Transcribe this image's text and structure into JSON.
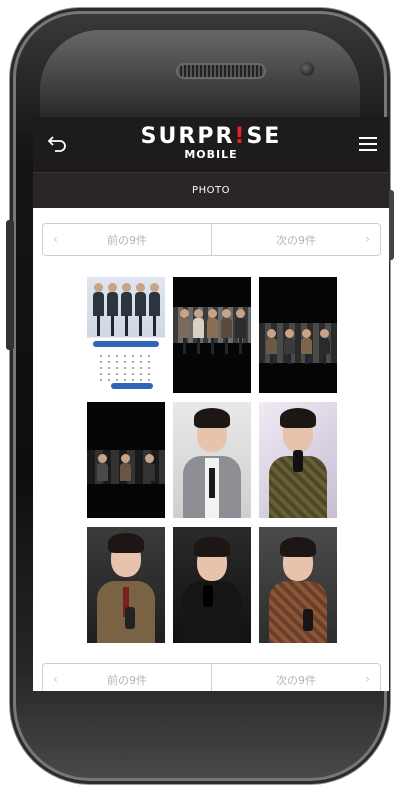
{
  "app": {
    "logo_main_prefix": "SURPR",
    "logo_main_mark": "!",
    "logo_main_suffix": "SE",
    "logo_sub": "MOBILE"
  },
  "subbar": {
    "title": "PHOTO"
  },
  "pager_top": {
    "prev": "前の9件",
    "next": "次の9件"
  },
  "pager_bottom": {
    "prev": "前の9件",
    "next": "次の9件"
  },
  "photos": [
    {
      "name": "group-calendar"
    },
    {
      "name": "group-stage-lineup"
    },
    {
      "name": "surprise-party-stage"
    },
    {
      "name": "surprise-party-panel"
    },
    {
      "name": "gray-suit-portrait"
    },
    {
      "name": "plaid-suit-mic"
    },
    {
      "name": "brown-suit-mic"
    },
    {
      "name": "black-shirt-mic"
    },
    {
      "name": "brown-check-suit-mic"
    }
  ],
  "colors": {
    "header_bg": "#1e1b1b",
    "subbar_bg": "#2a2626",
    "logo_accent": "#e4232a"
  }
}
